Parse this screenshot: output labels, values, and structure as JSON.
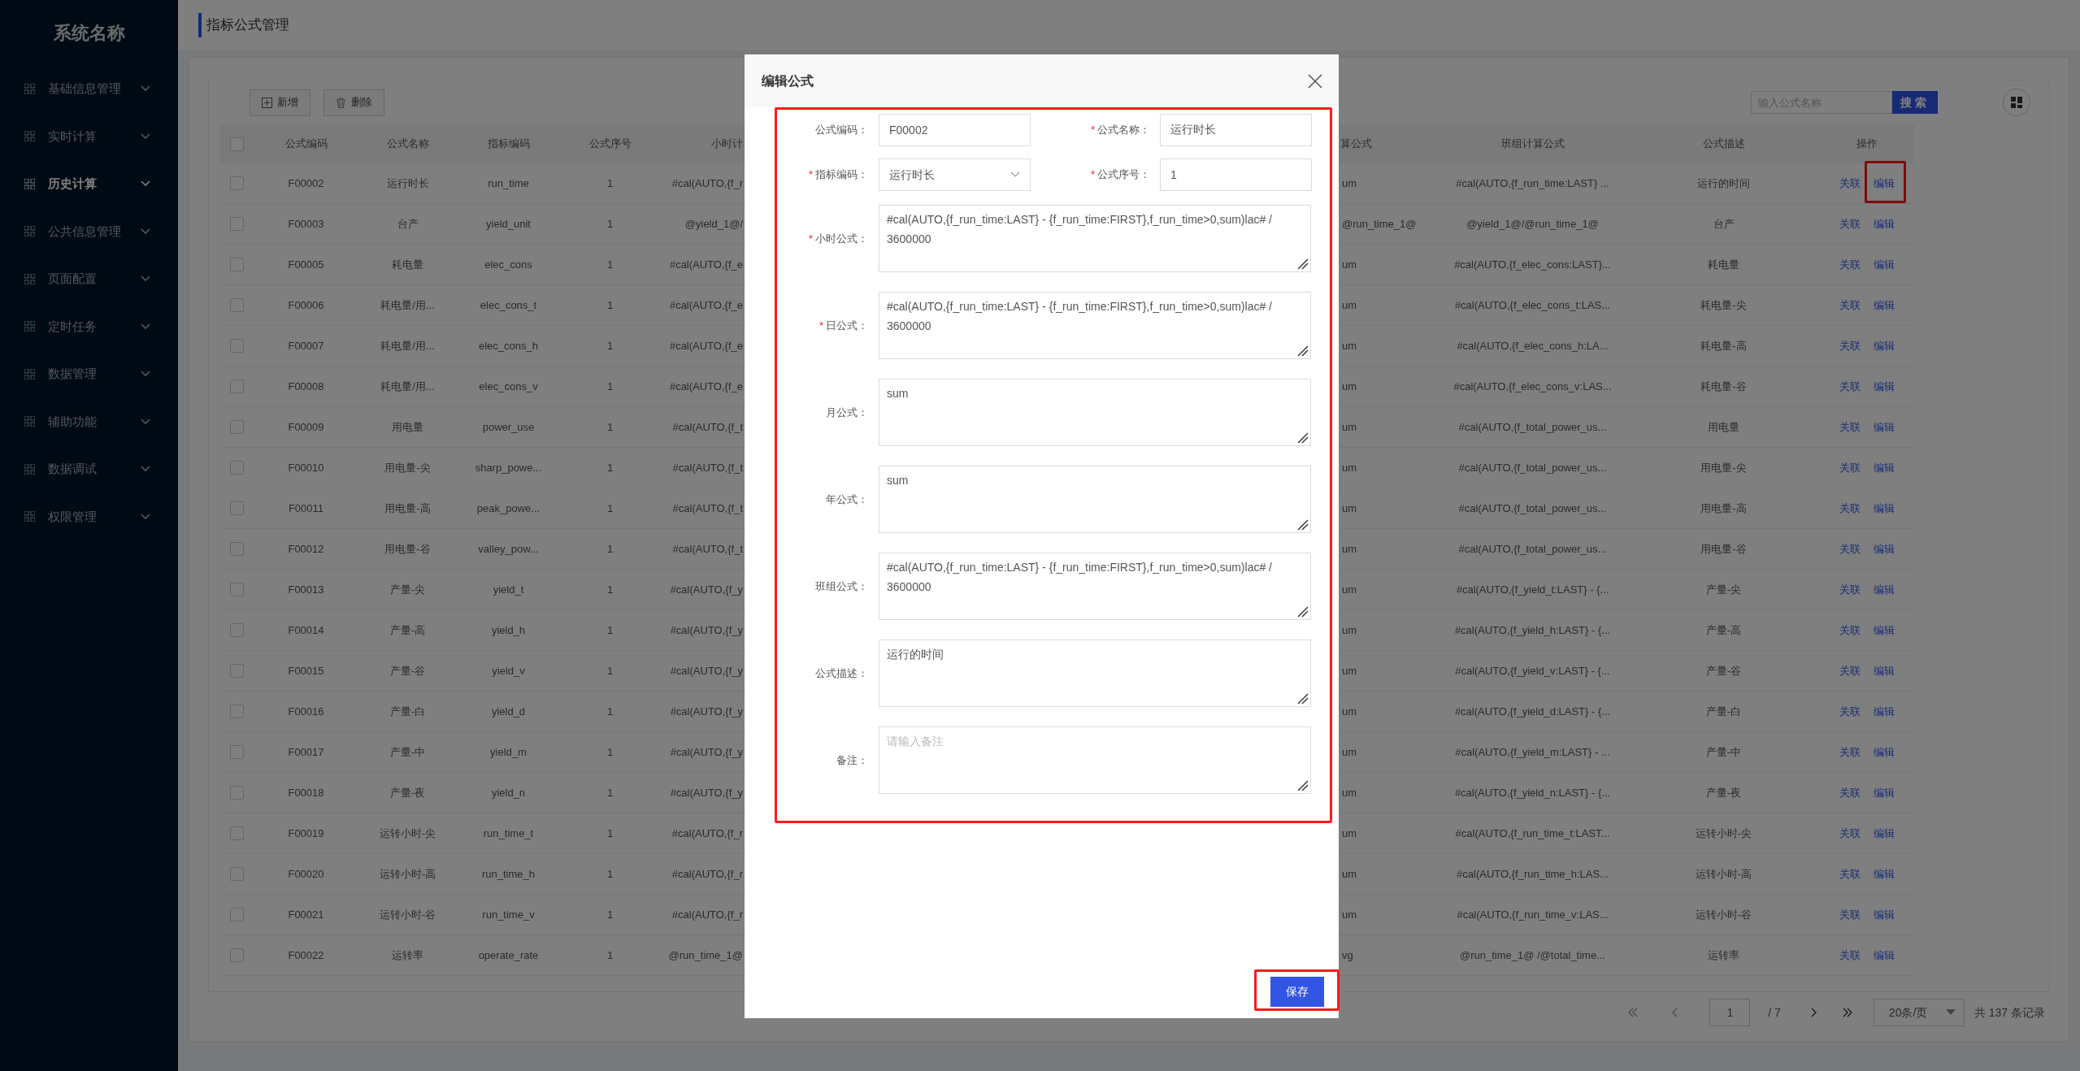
{
  "sidebar": {
    "title": "系统名称",
    "items": [
      {
        "label": "基础信息管理",
        "selected": false
      },
      {
        "label": "实时计算",
        "selected": false
      },
      {
        "label": "历史计算",
        "selected": true
      },
      {
        "label": "公共信息管理",
        "selected": false
      },
      {
        "label": "页面配置",
        "selected": false
      },
      {
        "label": "定时任务",
        "selected": false
      },
      {
        "label": "数据管理",
        "selected": false
      },
      {
        "label": "辅助功能",
        "selected": false
      },
      {
        "label": "数据调试",
        "selected": false
      },
      {
        "label": "权限管理",
        "selected": false
      }
    ]
  },
  "page_title": "指标公式管理",
  "toolbar": {
    "buttons": [
      {
        "label": "新增"
      },
      {
        "label": "删除"
      }
    ],
    "search": {
      "placeholder": "输入公式名称",
      "button": "搜索"
    }
  },
  "table": {
    "header_checked": false,
    "columns": [
      "公式编码",
      "公式名称",
      "指标编码",
      "公式序号",
      "小时计",
      "算公式",
      "班组计算公式",
      "公式描述",
      "操作"
    ],
    "rows": [
      {
        "checked": false,
        "cells": [
          "F00002",
          "运行时长",
          "run_time",
          "1",
          "#cal(AUTO,{f_r",
          "um",
          "#cal(AUTO,{f_run_time:LAST} ...",
          "运行的时间"
        ],
        "actions": [
          {
            "label": "关联",
            "annotated": false
          },
          {
            "label": "编辑",
            "annotated": true
          }
        ]
      },
      {
        "checked": false,
        "cells": [
          "F00003",
          "台产",
          "yield_unit",
          "1",
          "@yield_1@/",
          "@run_time_1@",
          "@yield_1@/@run_time_1@",
          "台产"
        ],
        "actions": [
          {
            "label": "关联",
            "annotated": false
          },
          {
            "label": "编辑",
            "annotated": false
          }
        ]
      },
      {
        "checked": false,
        "cells": [
          "F00005",
          "耗电量",
          "elec_cons",
          "1",
          "#cal(AUTO,{f_e",
          "um",
          "#cal(AUTO,{f_elec_cons:LAST}...",
          "耗电量"
        ],
        "actions": [
          {
            "label": "关联",
            "annotated": false
          },
          {
            "label": "编辑",
            "annotated": false
          }
        ]
      },
      {
        "checked": false,
        "cells": [
          "F00006",
          "耗电量/用...",
          "elec_cons_t",
          "1",
          "#cal(AUTO,{f_e",
          "um",
          "#cal(AUTO,{f_elec_cons_t:LAS...",
          "耗电量-尖"
        ],
        "actions": [
          {
            "label": "关联",
            "annotated": false
          },
          {
            "label": "编辑",
            "annotated": false
          }
        ]
      },
      {
        "checked": false,
        "cells": [
          "F00007",
          "耗电量/用...",
          "elec_cons_h",
          "1",
          "#cal(AUTO,{f_e",
          "um",
          "#cal(AUTO,{f_elec_cons_h:LA...",
          "耗电量-高"
        ],
        "actions": [
          {
            "label": "关联",
            "annotated": false
          },
          {
            "label": "编辑",
            "annotated": false
          }
        ]
      },
      {
        "checked": false,
        "cells": [
          "F00008",
          "耗电量/用...",
          "elec_cons_v",
          "1",
          "#cal(AUTO,{f_e",
          "um",
          "#cal(AUTO,{f_elec_cons_v:LAS...",
          "耗电量-谷"
        ],
        "actions": [
          {
            "label": "关联",
            "annotated": false
          },
          {
            "label": "编辑",
            "annotated": false
          }
        ]
      },
      {
        "checked": false,
        "cells": [
          "F00009",
          "用电量",
          "power_use",
          "1",
          "#cal(AUTO,{f_t",
          "um",
          "#cal(AUTO,{f_total_power_us...",
          "用电量"
        ],
        "actions": [
          {
            "label": "关联",
            "annotated": false
          },
          {
            "label": "编辑",
            "annotated": false
          }
        ]
      },
      {
        "checked": false,
        "cells": [
          "F00010",
          "用电量-尖",
          "sharp_powe...",
          "1",
          "#cal(AUTO,{f_t",
          "um",
          "#cal(AUTO,{f_total_power_us...",
          "用电量-尖"
        ],
        "actions": [
          {
            "label": "关联",
            "annotated": false
          },
          {
            "label": "编辑",
            "annotated": false
          }
        ]
      },
      {
        "checked": false,
        "cells": [
          "F00011",
          "用电量-高",
          "peak_powe...",
          "1",
          "#cal(AUTO,{f_t",
          "um",
          "#cal(AUTO,{f_total_power_us...",
          "用电量-高"
        ],
        "actions": [
          {
            "label": "关联",
            "annotated": false
          },
          {
            "label": "编辑",
            "annotated": false
          }
        ]
      },
      {
        "checked": false,
        "cells": [
          "F00012",
          "用电量-谷",
          "valley_pow...",
          "1",
          "#cal(AUTO,{f_t",
          "um",
          "#cal(AUTO,{f_total_power_us...",
          "用电量-谷"
        ],
        "actions": [
          {
            "label": "关联",
            "annotated": false
          },
          {
            "label": "编辑",
            "annotated": false
          }
        ]
      },
      {
        "checked": false,
        "cells": [
          "F00013",
          "产量-尖",
          "yield_t",
          "1",
          "#cal(AUTO,{f_y",
          "um",
          "#cal(AUTO,{f_yield_t:LAST} - {...",
          "产量-尖"
        ],
        "actions": [
          {
            "label": "关联",
            "annotated": false
          },
          {
            "label": "编辑",
            "annotated": false
          }
        ]
      },
      {
        "checked": false,
        "cells": [
          "F00014",
          "产量-高",
          "yield_h",
          "1",
          "#cal(AUTO,{f_y",
          "um",
          "#cal(AUTO,{f_yield_h:LAST} - {...",
          "产量-高"
        ],
        "actions": [
          {
            "label": "关联",
            "annotated": false
          },
          {
            "label": "编辑",
            "annotated": false
          }
        ]
      },
      {
        "checked": false,
        "cells": [
          "F00015",
          "产量-谷",
          "yield_v",
          "1",
          "#cal(AUTO,{f_y",
          "um",
          "#cal(AUTO,{f_yield_v:LAST} - {...",
          "产量-谷"
        ],
        "actions": [
          {
            "label": "关联",
            "annotated": false
          },
          {
            "label": "编辑",
            "annotated": false
          }
        ]
      },
      {
        "checked": false,
        "cells": [
          "F00016",
          "产量-白",
          "yield_d",
          "1",
          "#cal(AUTO,{f_y",
          "um",
          "#cal(AUTO,{f_yield_d:LAST} - {...",
          "产量-白"
        ],
        "actions": [
          {
            "label": "关联",
            "annotated": false
          },
          {
            "label": "编辑",
            "annotated": false
          }
        ]
      },
      {
        "checked": false,
        "cells": [
          "F00017",
          "产量-中",
          "yield_m",
          "1",
          "#cal(AUTO,{f_y",
          "um",
          "#cal(AUTO,{f_yield_m:LAST} - ...",
          "产量-中"
        ],
        "actions": [
          {
            "label": "关联",
            "annotated": false
          },
          {
            "label": "编辑",
            "annotated": false
          }
        ]
      },
      {
        "checked": false,
        "cells": [
          "F00018",
          "产量-夜",
          "yield_n",
          "1",
          "#cal(AUTO,{f_y",
          "um",
          "#cal(AUTO,{f_yield_n:LAST} - {...",
          "产量-夜"
        ],
        "actions": [
          {
            "label": "关联",
            "annotated": false
          },
          {
            "label": "编辑",
            "annotated": false
          }
        ]
      },
      {
        "checked": false,
        "cells": [
          "F00019",
          "运转小时-尖",
          "run_time_t",
          "1",
          "#cal(AUTO,{f_r",
          "um",
          "#cal(AUTO,{f_run_time_t:LAST...",
          "运转小时-尖"
        ],
        "actions": [
          {
            "label": "关联",
            "annotated": false
          },
          {
            "label": "编辑",
            "annotated": false
          }
        ]
      },
      {
        "checked": false,
        "cells": [
          "F00020",
          "运转小时-高",
          "run_time_h",
          "1",
          "#cal(AUTO,{f_r",
          "um",
          "#cal(AUTO,{f_run_time_h:LAS...",
          "运转小时-高"
        ],
        "actions": [
          {
            "label": "关联",
            "annotated": false
          },
          {
            "label": "编辑",
            "annotated": false
          }
        ]
      },
      {
        "checked": false,
        "cells": [
          "F00021",
          "运转小时-谷",
          "run_time_v",
          "1",
          "#cal(AUTO,{f_r",
          "um",
          "#cal(AUTO,{f_run_time_v:LAS...",
          "运转小时-谷"
        ],
        "actions": [
          {
            "label": "关联",
            "annotated": false
          },
          {
            "label": "编辑",
            "annotated": false
          }
        ]
      },
      {
        "checked": false,
        "cells": [
          "F00022",
          "运转率",
          "operate_rate",
          "1",
          "@run_time_1@",
          "vg",
          "@run_time_1@ /@total_time...",
          "运转率"
        ],
        "actions": [
          {
            "label": "关联",
            "annotated": false
          },
          {
            "label": "编辑",
            "annotated": false
          }
        ]
      }
    ]
  },
  "pagination": {
    "page": "1",
    "total_pages": "/ 7",
    "page_size": "20条/页",
    "total": "共 137 条记录"
  },
  "dialog": {
    "title": "编辑公式",
    "form_annotated": true,
    "fields": [
      {
        "kind": "input",
        "label": "公式编码：",
        "value": "F00002"
      },
      {
        "kind": "input",
        "label": "公式名称：",
        "required_mark": "*",
        "value": "运行时长"
      },
      {
        "kind": "select",
        "label": "指标编码：",
        "required_mark": "*",
        "value": "运行时长"
      },
      {
        "kind": "input",
        "label": "公式序号：",
        "required_mark": "*",
        "value": "1"
      },
      {
        "kind": "textarea",
        "label": "小时公式：",
        "required_mark": "*",
        "value": "#cal(AUTO,{f_run_time:LAST} - {f_run_time:FIRST},f_run_time>0,sum)lac# / 3600000"
      },
      {
        "kind": "textarea",
        "label": "日公式：",
        "required_mark": "*",
        "value": "#cal(AUTO,{f_run_time:LAST} - {f_run_time:FIRST},f_run_time>0,sum)lac# / 3600000"
      },
      {
        "kind": "textarea",
        "label": "月公式：",
        "value": "sum"
      },
      {
        "kind": "textarea",
        "label": "年公式：",
        "value": "sum"
      },
      {
        "kind": "textarea",
        "label": "班组公式：",
        "value": "#cal(AUTO,{f_run_time:LAST} - {f_run_time:FIRST},f_run_time>0,sum)lac# / 3600000"
      },
      {
        "kind": "textarea",
        "label": "公式描述：",
        "value": "运行的时间"
      },
      {
        "kind": "textarea",
        "label": "备注：",
        "placeholder": "请输入备注"
      }
    ],
    "save": {
      "label": "保存",
      "annotated": true
    }
  }
}
